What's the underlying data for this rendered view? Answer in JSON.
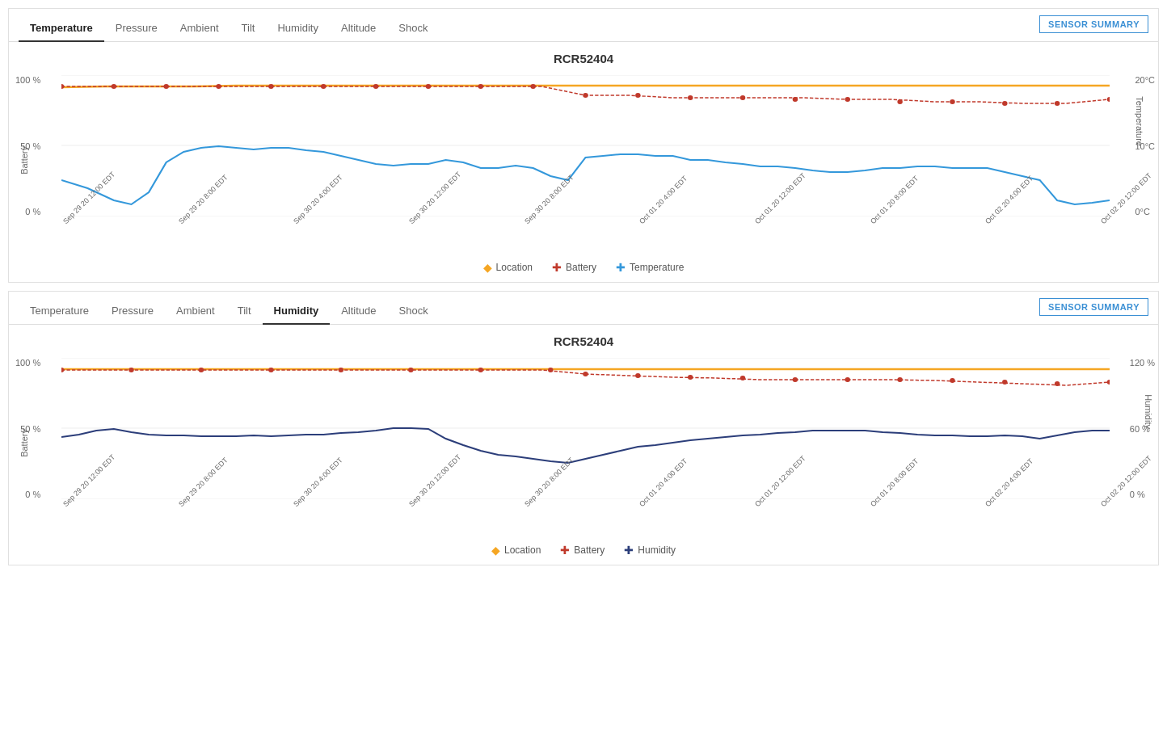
{
  "panel1": {
    "tabs": [
      "Temperature",
      "Pressure",
      "Ambient",
      "Tilt",
      "Humidity",
      "Altitude",
      "Shock"
    ],
    "activeTab": "Temperature",
    "sensorSummaryLabel": "SENSOR SUMMARY",
    "title": "RCR52404",
    "yLeftLabel": "Battery",
    "yRightLabel": "Temperature",
    "yLeftTicks": [
      "100 %",
      "50 %",
      "0 %"
    ],
    "yRightTicks": [
      "20°C",
      "10°C",
      "0°C"
    ],
    "xTicks": [
      "Sep 29 20 12:00 EDT",
      "Sep 29 20 8:00 EDT",
      "Sep 30 20 4:00 EDT",
      "Sep 30 20 12:00 EDT",
      "Sep 30 20 8:00 EDT",
      "Oct 01 20 4:00 EDT",
      "Oct 01 20 12:00 EDT",
      "Oct 01 20 8:00 EDT",
      "Oct 02 20 4:00 EDT",
      "Oct 02 20 12:00 EDT"
    ],
    "legend": [
      {
        "label": "Location",
        "color": "#f5a623",
        "type": "orange"
      },
      {
        "label": "Battery",
        "color": "#c0392b",
        "type": "red"
      },
      {
        "label": "Temperature",
        "color": "#3498db",
        "type": "blue"
      }
    ]
  },
  "panel2": {
    "tabs": [
      "Temperature",
      "Pressure",
      "Ambient",
      "Tilt",
      "Humidity",
      "Altitude",
      "Shock"
    ],
    "activeTab": "Humidity",
    "sensorSummaryLabel": "SENSOR SUMMARY",
    "title": "RCR52404",
    "yLeftLabel": "Battery",
    "yRightLabel": "Humidity",
    "yLeftTicks": [
      "100 %",
      "50 %",
      "0 %"
    ],
    "yRightTicks": [
      "120 %",
      "60 %",
      "0 %"
    ],
    "xTicks": [
      "Sep 29 20 12:00 EDT",
      "Sep 29 20 8:00 EDT",
      "Sep 30 20 4:00 EDT",
      "Sep 30 20 12:00 EDT",
      "Sep 30 20 8:00 EDT",
      "Oct 01 20 4:00 EDT",
      "Oct 01 20 12:00 EDT",
      "Oct 01 20 8:00 EDT",
      "Oct 02 20 4:00 EDT",
      "Oct 02 20 12:00 EDT"
    ],
    "legend": [
      {
        "label": "Location",
        "color": "#f5a623",
        "type": "orange"
      },
      {
        "label": "Battery",
        "color": "#c0392b",
        "type": "red"
      },
      {
        "label": "Humidity",
        "color": "#2c3e7a",
        "type": "darkblue"
      }
    ]
  }
}
